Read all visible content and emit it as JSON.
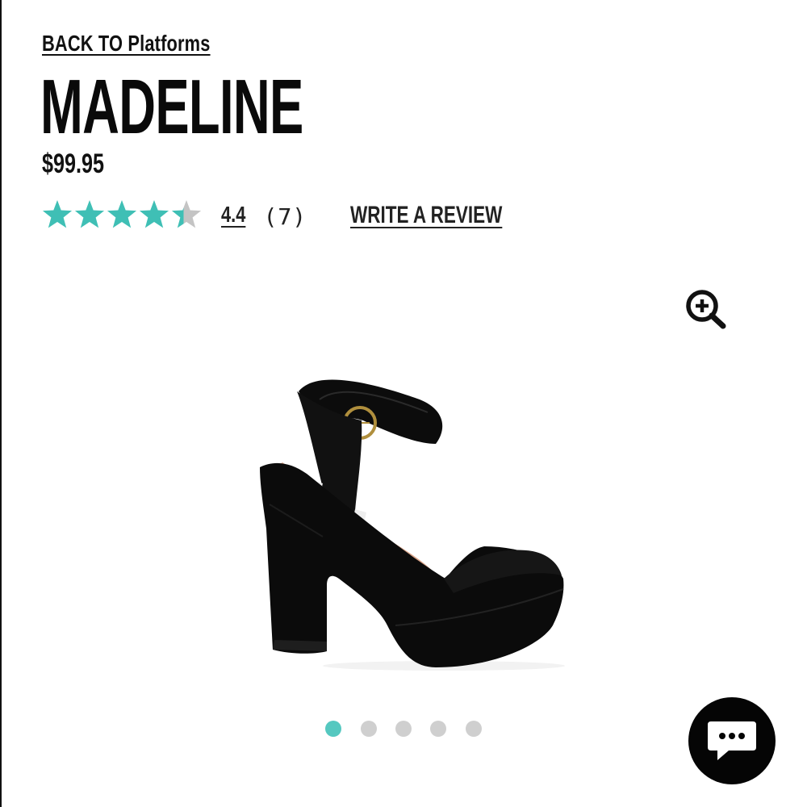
{
  "header": {
    "back_link": "BACK TO Platforms"
  },
  "product": {
    "name": "MADELINE",
    "price": "$99.95"
  },
  "rating": {
    "value": "4.4",
    "count": "(7)",
    "stars": 4.4,
    "max_stars": 5,
    "write_review_label": "WRITE A REVIEW"
  },
  "gallery": {
    "image_count": 5,
    "active_index": 0
  },
  "icons": {
    "zoom": "zoom-in-icon",
    "chat": "chat-bubble-icon",
    "star": "star-icon"
  },
  "colors": {
    "star_filled": "#3fbfb5",
    "star_empty": "#c4c4c4",
    "dot_active": "#55c8c0",
    "dot_inactive": "#cfcfcf",
    "text": "#111111"
  }
}
